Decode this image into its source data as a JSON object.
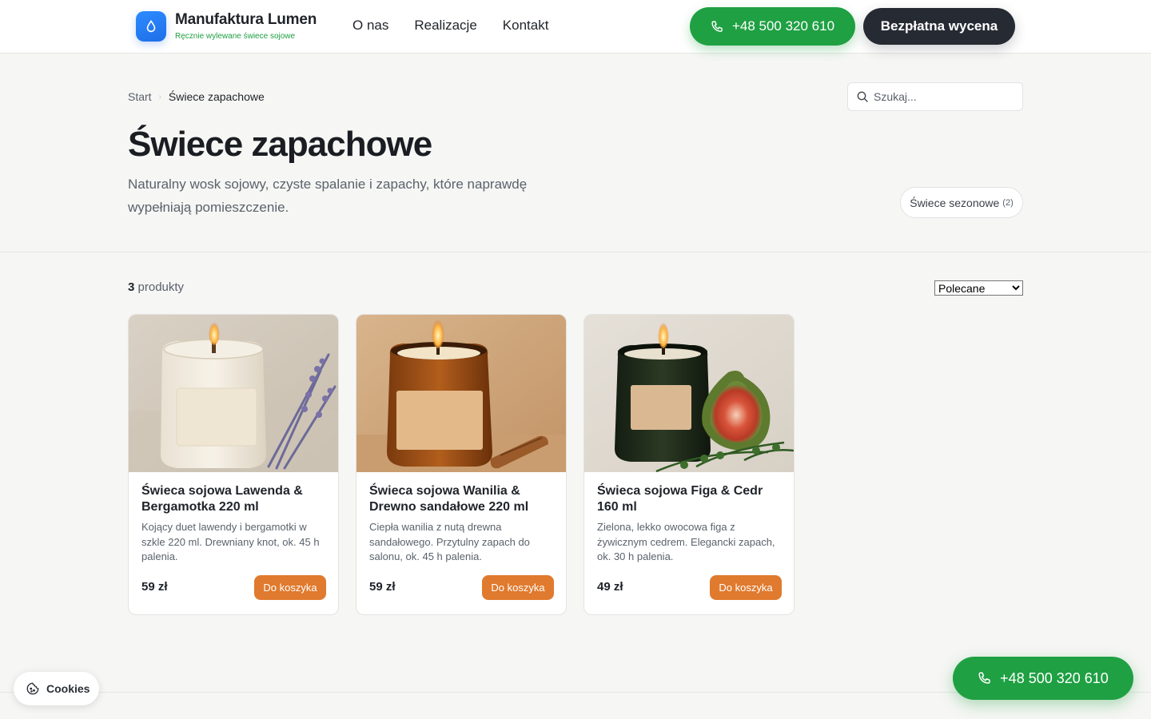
{
  "header": {
    "brand_name": "Manufaktura Lumen",
    "brand_tagline": "Ręcznie wylewane świece sojowe",
    "nav": [
      {
        "label": "O nas"
      },
      {
        "label": "Realizacje"
      },
      {
        "label": "Kontakt"
      }
    ],
    "phone_label": "+48 500 320 610",
    "quote_label": "Bezpłatna wycena"
  },
  "breadcrumb": {
    "start": "Start",
    "separator": "›",
    "current": "Świece zapachowe"
  },
  "search": {
    "placeholder": "Szukaj..."
  },
  "hero": {
    "title": "Świece zapachowe",
    "lead": "Naturalny wosk sojowy, czyste spalanie i zapachy, które naprawdę wypełniają pomieszczenie."
  },
  "category_chip": {
    "label": "Świece sezonowe",
    "count": "(2)"
  },
  "listing": {
    "count": "3",
    "count_label": "produkty",
    "sort_selected": "Polecane"
  },
  "products": [
    {
      "title": "Świeca sojowa Lawenda & Bergamotka 220 ml",
      "description": "Kojący duet lawendy i bergamotki w szkle 220 ml. Drewniany knot, ok. 45 h palenia.",
      "price": "59 zł",
      "button": "Do koszyka"
    },
    {
      "title": "Świeca sojowa Wanilia & Drewno sandałowe 220 ml",
      "description": "Ciepła wanilia z nutą drewna sandałowego. Przytulny zapach do salonu, ok. 45 h palenia.",
      "price": "59 zł",
      "button": "Do koszyka"
    },
    {
      "title": "Świeca sojowa Figa & Cedr 160 ml",
      "description": "Zielona, lekko owocowa figa z żywicznym cedrem. Elegancki zapach, ok. 30 h palenia.",
      "price": "49 zł",
      "button": "Do koszyka"
    }
  ],
  "cookie_label": "Cookies",
  "floating_phone_label": "+48 500 320 610",
  "colors": {
    "accent_green": "#1fa043",
    "dark_button": "#262b33",
    "cart_orange": "#e07a2e",
    "logo_blue": "#2d8cff"
  },
  "icons": [
    "drop-icon",
    "phone-icon",
    "search-icon",
    "cookie-icon"
  ]
}
